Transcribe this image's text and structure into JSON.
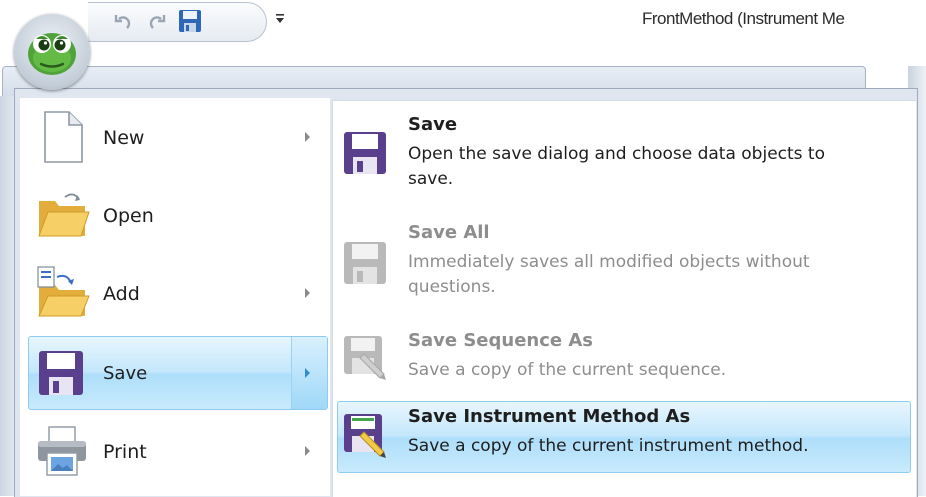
{
  "window": {
    "title": "FrontMethod (Instrument Me"
  },
  "quick_access": {
    "undo_icon": "undo-icon",
    "redo_icon": "redo-icon",
    "save_icon": "save-icon",
    "customize_icon": "customize-qat-icon"
  },
  "app_menu": {
    "items": [
      {
        "label": "New",
        "icon": "new-document-icon",
        "has_submenu": true
      },
      {
        "label": "Open",
        "icon": "open-folder-icon",
        "has_submenu": false
      },
      {
        "label": "Add",
        "icon": "add-folder-icon",
        "has_submenu": true
      },
      {
        "label": "Save",
        "icon": "save-icon",
        "has_submenu": true,
        "active": true
      },
      {
        "label": "Print",
        "icon": "printer-icon",
        "has_submenu": true
      }
    ]
  },
  "save_submenu": {
    "items": [
      {
        "title": "Save",
        "description": "Open the save dialog and choose data objects to save.",
        "icon": "save-icon",
        "enabled": true
      },
      {
        "title": "Save All",
        "description": "Immediately saves all modified objects without questions.",
        "icon": "save-all-icon",
        "enabled": false
      },
      {
        "title": "Save Sequence As",
        "description": "Save a copy of the current sequence.",
        "icon": "save-sequence-as-icon",
        "enabled": false
      },
      {
        "title": "Save Instrument Method As",
        "description": "Save a copy of the current instrument method.",
        "icon": "save-method-as-icon",
        "enabled": true,
        "hovered": true
      }
    ]
  },
  "colors": {
    "accent": "#5a3f8c",
    "highlight": "#aedefa",
    "highlight_border": "#8fcbef"
  }
}
